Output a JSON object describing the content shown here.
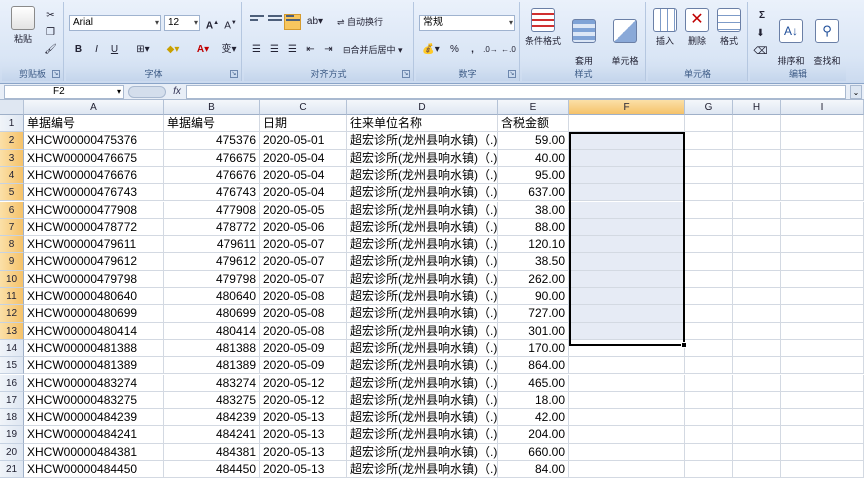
{
  "ribbon": {
    "clipboard": {
      "paste_label": "粘贴",
      "group_label": "剪贴板"
    },
    "font": {
      "font_name": "Arial",
      "font_size": "12",
      "bold": "B",
      "italic": "I",
      "underline": "U",
      "wen": "变",
      "group_label": "字体"
    },
    "alignment": {
      "wrap_label": "自动换行",
      "merge_label": "合并后居中 ▾",
      "group_label": "对齐方式"
    },
    "number": {
      "format_value": "常规",
      "percent": "%",
      "comma": ",",
      "group_label": "数字"
    },
    "styles": {
      "conditional_label": "条件格式",
      "table_label": "套用\n表格格式",
      "cell_style_label": "单元格\n样式",
      "group_label": "样式"
    },
    "cells": {
      "insert_label": "插入",
      "delete_label": "删除",
      "format_label": "格式",
      "group_label": "单元格"
    },
    "editing": {
      "sigma": "Σ",
      "sort_label": "排序和\n筛选",
      "find_label": "查找和\n选择",
      "group_label": "编辑"
    }
  },
  "formula_bar": {
    "name_box": "F2",
    "fx": "fx",
    "content": ""
  },
  "columns": [
    "A",
    "B",
    "C",
    "D",
    "E",
    "F",
    "G",
    "H",
    "I"
  ],
  "header_row": {
    "num": "1",
    "a": "单据编号",
    "b": "单据编号",
    "c": "日期",
    "d": "往来单位名称",
    "e": "含税金额"
  },
  "rows": [
    {
      "num": "2",
      "a": "XHCW00000475376",
      "b": "475376",
      "c": "2020-05-01",
      "d": "超宏诊所(龙州县响水镇)（.)",
      "e": "59.00"
    },
    {
      "num": "3",
      "a": "XHCW00000476675",
      "b": "476675",
      "c": "2020-05-04",
      "d": "超宏诊所(龙州县响水镇)（.)",
      "e": "40.00"
    },
    {
      "num": "4",
      "a": "XHCW00000476676",
      "b": "476676",
      "c": "2020-05-04",
      "d": "超宏诊所(龙州县响水镇)（.)",
      "e": "95.00"
    },
    {
      "num": "5",
      "a": "XHCW00000476743",
      "b": "476743",
      "c": "2020-05-04",
      "d": "超宏诊所(龙州县响水镇)（.)",
      "e": "637.00"
    },
    {
      "num": "6",
      "a": "XHCW00000477908",
      "b": "477908",
      "c": "2020-05-05",
      "d": "超宏诊所(龙州县响水镇)（.)",
      "e": "38.00"
    },
    {
      "num": "7",
      "a": "XHCW00000478772",
      "b": "478772",
      "c": "2020-05-06",
      "d": "超宏诊所(龙州县响水镇)（.)",
      "e": "88.00"
    },
    {
      "num": "8",
      "a": "XHCW00000479611",
      "b": "479611",
      "c": "2020-05-07",
      "d": "超宏诊所(龙州县响水镇)（.)",
      "e": "120.10"
    },
    {
      "num": "9",
      "a": "XHCW00000479612",
      "b": "479612",
      "c": "2020-05-07",
      "d": "超宏诊所(龙州县响水镇)（.)",
      "e": "38.50"
    },
    {
      "num": "10",
      "a": "XHCW00000479798",
      "b": "479798",
      "c": "2020-05-07",
      "d": "超宏诊所(龙州县响水镇)（.)",
      "e": "262.00"
    },
    {
      "num": "11",
      "a": "XHCW00000480640",
      "b": "480640",
      "c": "2020-05-08",
      "d": "超宏诊所(龙州县响水镇)（.)",
      "e": "90.00"
    },
    {
      "num": "12",
      "a": "XHCW00000480699",
      "b": "480699",
      "c": "2020-05-08",
      "d": "超宏诊所(龙州县响水镇)（.)",
      "e": "727.00"
    },
    {
      "num": "13",
      "a": "XHCW00000480414",
      "b": "480414",
      "c": "2020-05-08",
      "d": "超宏诊所(龙州县响水镇)（.)",
      "e": "301.00"
    },
    {
      "num": "14",
      "a": "XHCW00000481388",
      "b": "481388",
      "c": "2020-05-09",
      "d": "超宏诊所(龙州县响水镇)（.)",
      "e": "170.00"
    },
    {
      "num": "15",
      "a": "XHCW00000481389",
      "b": "481389",
      "c": "2020-05-09",
      "d": "超宏诊所(龙州县响水镇)（.)",
      "e": "864.00"
    },
    {
      "num": "16",
      "a": "XHCW00000483274",
      "b": "483274",
      "c": "2020-05-12",
      "d": "超宏诊所(龙州县响水镇)（.)",
      "e": "465.00"
    },
    {
      "num": "17",
      "a": "XHCW00000483275",
      "b": "483275",
      "c": "2020-05-12",
      "d": "超宏诊所(龙州县响水镇)（.)",
      "e": "18.00"
    },
    {
      "num": "18",
      "a": "XHCW00000484239",
      "b": "484239",
      "c": "2020-05-13",
      "d": "超宏诊所(龙州县响水镇)（.)",
      "e": "42.00"
    },
    {
      "num": "19",
      "a": "XHCW00000484241",
      "b": "484241",
      "c": "2020-05-13",
      "d": "超宏诊所(龙州县响水镇)（.)",
      "e": "204.00"
    },
    {
      "num": "20",
      "a": "XHCW00000484381",
      "b": "484381",
      "c": "2020-05-13",
      "d": "超宏诊所(龙州县响水镇)（.)",
      "e": "660.00"
    },
    {
      "num": "21",
      "a": "XHCW00000484450",
      "b": "484450",
      "c": "2020-05-13",
      "d": "超宏诊所(龙州县响水镇)（.)",
      "e": "84.00"
    }
  ]
}
